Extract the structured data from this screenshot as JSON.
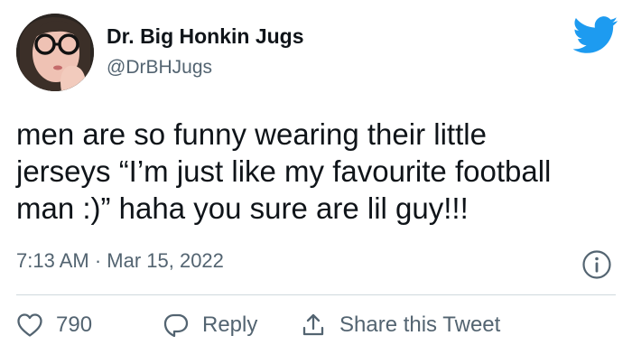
{
  "author": {
    "name": "Dr. Big Honkin Jugs",
    "handle": "@DrBHJugs"
  },
  "tweet": {
    "lines": [
      "men are so funny wearing their little",
      "jerseys “I’m just like my favourite football",
      "man :)” haha you sure are lil guy!!!"
    ],
    "timestamp": "7:13 AM · Mar 15, 2022"
  },
  "actions": {
    "like_count": "790",
    "reply_label": "Reply",
    "share_label": "Share this Tweet"
  },
  "icons": {
    "brand": "twitter-bird-icon",
    "info": "info-icon",
    "like": "heart-icon",
    "reply": "speech-bubble-icon",
    "share": "share-upload-icon"
  },
  "colors": {
    "brand_blue": "#1d9bf0",
    "text_primary": "#0f1419",
    "text_secondary": "#536471",
    "divider": "#cfd9de"
  }
}
